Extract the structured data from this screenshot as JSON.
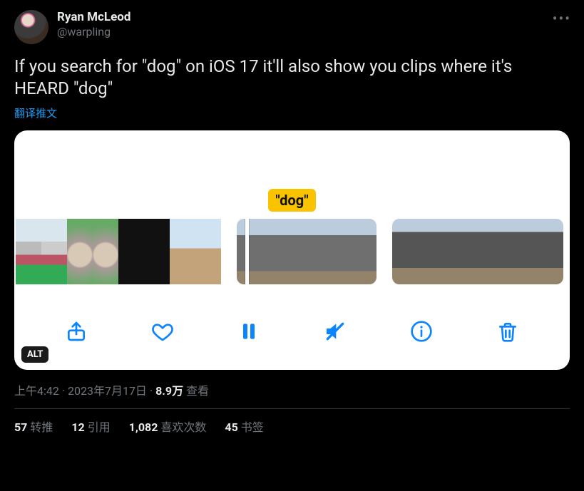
{
  "author": {
    "display_name": "Ryan McLeod",
    "handle": "@warpling"
  },
  "more_menu_glyph": "•••",
  "body_text": "If you search for \"dog\" on iOS 17 it'll also show you clips where it's HEARD \"dog\"",
  "translate_label": "翻译推文",
  "media": {
    "caption_pill": "\"dog\"",
    "alt_badge": "ALT",
    "toolbar": {
      "share": "share",
      "like": "like",
      "pause": "pause",
      "mute": "mute",
      "info": "info",
      "trash": "trash"
    }
  },
  "meta": {
    "time": "上午4:42",
    "sep1": " · ",
    "date": "2023年7月17日",
    "sep2": " · ",
    "views_number": "8.9万",
    "views_label": " 查看"
  },
  "stats": {
    "retweets": {
      "count": "57",
      "label": "转推"
    },
    "quotes": {
      "count": "12",
      "label": "引用"
    },
    "likes": {
      "count": "1,082",
      "label": "喜欢次数"
    },
    "bookmarks": {
      "count": "45",
      "label": "书签"
    }
  }
}
